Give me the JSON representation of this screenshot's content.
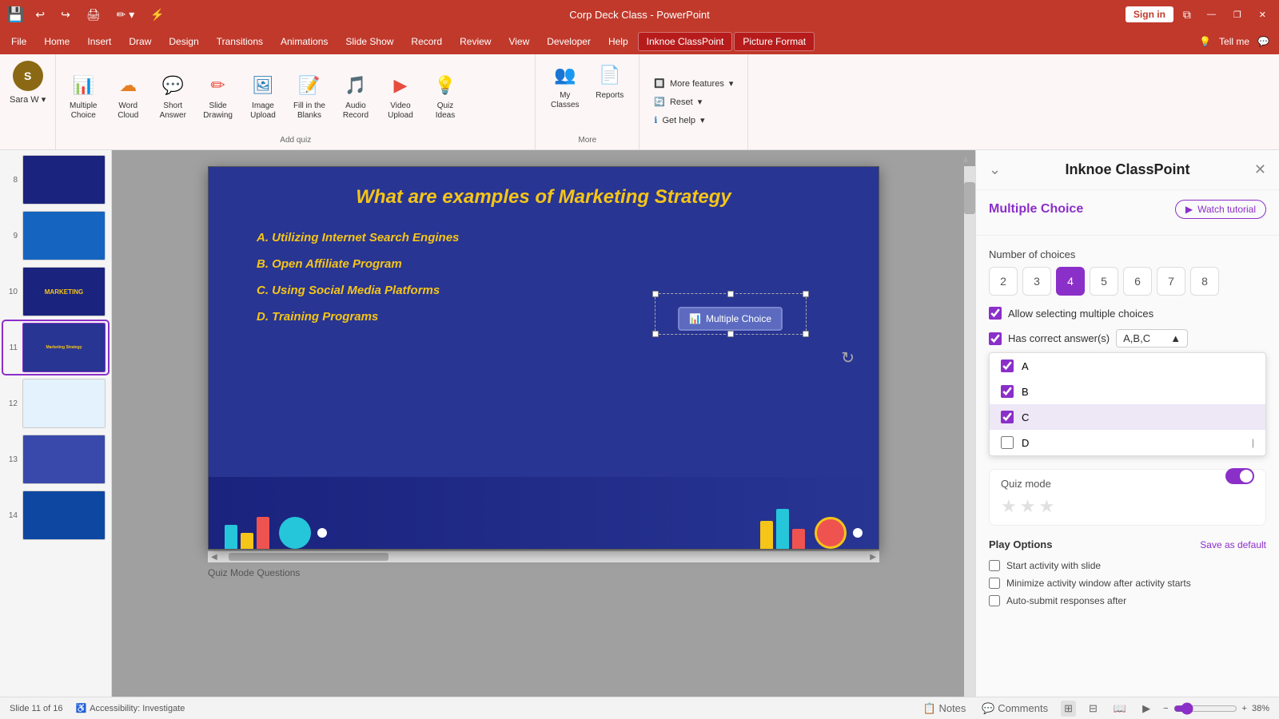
{
  "titleBar": {
    "title": "Corp Deck Class - PowerPoint",
    "signIn": "Sign in",
    "minimize": "—",
    "restore": "❐",
    "close": "✕"
  },
  "menuBar": {
    "items": [
      "File",
      "Home",
      "Insert",
      "Draw",
      "Design",
      "Transitions",
      "Animations",
      "Slide Show",
      "Record",
      "Review",
      "View",
      "Developer",
      "Help"
    ],
    "activeItem": "Inknoe ClassPoint",
    "secondActive": "Picture Format",
    "tell": "Tell me"
  },
  "ribbon": {
    "user": {
      "name": "Sara W",
      "initials": "S"
    },
    "addQuizLabel": "Add quiz",
    "moreLabel": "More",
    "buttons": [
      {
        "id": "multiple-choice",
        "label": "Multiple\nChoice",
        "icon": "📊"
      },
      {
        "id": "word-cloud",
        "label": "Word\nCloud",
        "icon": "☁"
      },
      {
        "id": "short-answer",
        "label": "Short\nAnswer",
        "icon": "💬"
      },
      {
        "id": "slide-drawing",
        "label": "Slide\nDrawing",
        "icon": "✏"
      },
      {
        "id": "image-upload",
        "label": "Image\nUpload",
        "icon": "🖼"
      },
      {
        "id": "fill-blanks",
        "label": "Fill in the\nBlanks",
        "icon": "📝"
      },
      {
        "id": "audio-record",
        "label": "Audio\nRecord",
        "icon": "🎵"
      },
      {
        "id": "video-upload",
        "label": "Video\nUpload",
        "icon": "▶"
      },
      {
        "id": "quiz-ideas",
        "label": "Quiz\nIdeas",
        "icon": "💡"
      },
      {
        "id": "my-classes",
        "label": "My\nClasses",
        "icon": "👥"
      },
      {
        "id": "reports",
        "label": "Reports",
        "icon": "📄"
      }
    ],
    "moreFeatures": "More features",
    "reset": "Reset",
    "getHelp": "Get help"
  },
  "slides": [
    {
      "num": 8,
      "type": "dark"
    },
    {
      "num": 9,
      "type": "blue"
    },
    {
      "num": 10,
      "type": "mid"
    },
    {
      "num": 11,
      "type": "active"
    },
    {
      "num": 12,
      "type": "light"
    },
    {
      "num": 13,
      "type": "mid"
    },
    {
      "num": 14,
      "type": "dark"
    }
  ],
  "slide": {
    "title": "What are examples of Marketing Strategy",
    "options": [
      "A. Utilizing Internet Search Engines",
      "B. Open Affiliate Program",
      "C. Using Social Media Platforms",
      "D. Training Programs"
    ],
    "badge": "Multiple Choice"
  },
  "slideInfo": {
    "slideNum": "Slide 11 of 16",
    "quizLabel": "Quiz Mode Questions",
    "notes": "Notes",
    "comments": "Comments",
    "accessibility": "Accessibility: Investigate",
    "zoom": "38%"
  },
  "classpointPanel": {
    "title": "Inknoe ClassPoint",
    "mcTitle": "Multiple Choice",
    "watchTutorial": "Watch tutorial",
    "numberOfChoices": "Number of choices",
    "choices": [
      "2",
      "3",
      "4",
      "5",
      "6",
      "7",
      "8"
    ],
    "activeChoice": 4,
    "allowMultiple": "Allow selecting multiple choices",
    "hasCorrectAnswer": "Has correct answer(s)",
    "correctAnswerValue": "A,B,C",
    "dropdownItems": [
      {
        "label": "A",
        "checked": true
      },
      {
        "label": "B",
        "checked": true
      },
      {
        "label": "C",
        "checked": true
      },
      {
        "label": "D",
        "checked": false
      }
    ],
    "quizMode": "Quiz mode",
    "playOptions": "Play Options",
    "saveAsDefault": "Save as default",
    "playOptionsList": [
      "Start activity with slide",
      "Minimize activity window after activity starts",
      "Auto-submit responses after"
    ]
  }
}
